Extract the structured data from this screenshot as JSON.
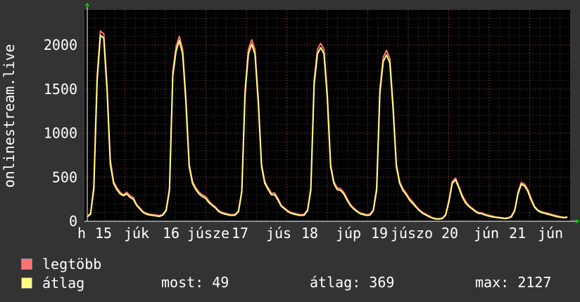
{
  "chart_data": {
    "type": "line",
    "ylabel": "onlinestream.live",
    "y_ticks": [
      "0",
      "500",
      "1000",
      "1500",
      "2000"
    ],
    "ylim": [
      0,
      2400
    ],
    "x_tick_labels": [
      "h",
      "15",
      "júk",
      "16",
      "júsze",
      "17",
      "jús",
      "18",
      "júp",
      "19",
      "júszo",
      "20",
      "jún",
      "21",
      "jún"
    ],
    "grid": true,
    "series": [
      {
        "name": "legtöbb",
        "color": "#ff7373",
        "values": [
          60,
          90,
          400,
          1650,
          2160,
          2130,
          1550,
          700,
          450,
          380,
          330,
          300,
          330,
          290,
          270,
          190,
          150,
          110,
          90,
          80,
          75,
          70,
          65,
          80,
          130,
          380,
          1700,
          1980,
          2100,
          1950,
          1400,
          650,
          450,
          380,
          330,
          300,
          280,
          230,
          190,
          160,
          120,
          100,
          90,
          80,
          75,
          80,
          120,
          350,
          1500,
          1950,
          2060,
          1950,
          1400,
          650,
          450,
          380,
          320,
          320,
          260,
          180,
          150,
          120,
          100,
          90,
          80,
          75,
          80,
          130,
          380,
          1600,
          1950,
          2020,
          1950,
          1450,
          650,
          450,
          380,
          370,
          330,
          260,
          190,
          150,
          120,
          95,
          85,
          75,
          80,
          130,
          380,
          1500,
          1860,
          1940,
          1850,
          1330,
          650,
          450,
          370,
          320,
          260,
          220,
          170,
          130,
          100,
          80,
          60,
          40,
          30,
          30,
          35,
          80,
          240,
          450,
          490,
          400,
          300,
          230,
          180,
          150,
          120,
          100,
          95,
          80,
          70,
          60,
          50,
          45,
          40,
          35,
          40,
          60,
          130,
          330,
          440,
          420,
          360,
          260,
          170,
          130,
          110,
          100,
          90,
          80,
          70,
          60,
          50,
          45,
          40
        ]
      },
      {
        "name": "átlag",
        "color": "#ffff80",
        "values": [
          50,
          80,
          370,
          1600,
          2110,
          2080,
          1500,
          650,
          430,
          360,
          310,
          290,
          310,
          270,
          250,
          180,
          140,
          100,
          80,
          70,
          65,
          60,
          55,
          70,
          120,
          350,
          1650,
          1930,
          2050,
          1900,
          1350,
          620,
          430,
          360,
          310,
          280,
          260,
          210,
          180,
          150,
          110,
          90,
          80,
          70,
          65,
          70,
          110,
          330,
          1450,
          1900,
          2010,
          1900,
          1350,
          620,
          430,
          360,
          300,
          300,
          240,
          170,
          140,
          110,
          90,
          80,
          70,
          65,
          70,
          120,
          350,
          1550,
          1900,
          1970,
          1900,
          1400,
          620,
          430,
          360,
          350,
          310,
          240,
          180,
          140,
          110,
          85,
          75,
          65,
          70,
          120,
          350,
          1450,
          1810,
          1890,
          1800,
          1280,
          620,
          430,
          350,
          300,
          240,
          200,
          160,
          120,
          90,
          70,
          50,
          35,
          25,
          25,
          30,
          70,
          220,
          430,
          470,
          380,
          280,
          210,
          170,
          140,
          110,
          90,
          85,
          70,
          60,
          50,
          45,
          40,
          35,
          30,
          35,
          50,
          120,
          310,
          420,
          400,
          340,
          240,
          160,
          120,
          100,
          90,
          80,
          70,
          60,
          50,
          45,
          40,
          49
        ]
      }
    ]
  },
  "legend": {
    "max_label": "legtöbb",
    "avg_label": "átlag"
  },
  "stats": {
    "now": "most: 49",
    "avg": "átlag: 369",
    "max": "max: 2127"
  }
}
